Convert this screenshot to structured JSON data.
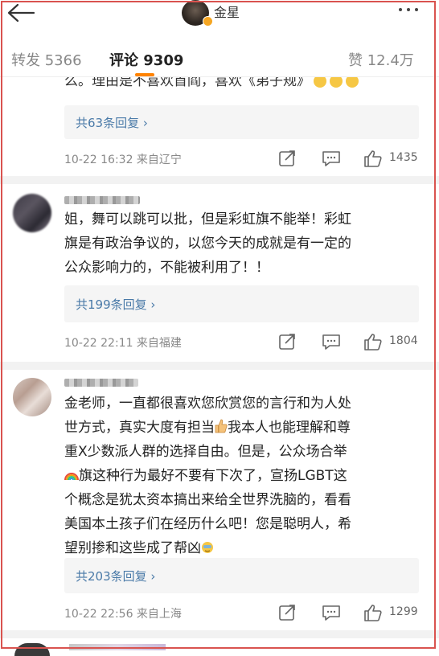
{
  "header": {
    "username": "金星",
    "back_icon": "back-arrow-icon",
    "more_icon": "more-dots-icon"
  },
  "tabs": [
    {
      "label": "转发 5366",
      "active": false
    },
    {
      "label": "评论 9309",
      "active": true
    },
    {
      "label": "赞 12.4万",
      "active": false
    }
  ],
  "accent_color": "#ff8200",
  "link_color": "#4a7aa8",
  "comments": [
    {
      "partial_text": "么。理由是不喜欢首阎，喜欢《弟子规》",
      "replies_label": "共63条回复 ›",
      "time_location": "10-22 16:32  来自辽宁",
      "likes": "1435"
    },
    {
      "lines": [
        "姐，舞可以跳可以批，但是彩虹旗不能举！彩虹",
        "旗是有政治争议的，以您今天的成就是有一定的",
        "公众影响力的，不能被利用了！！"
      ],
      "replies_label": "共199条回复 ›",
      "time_location": "10-22 22:11  来自福建",
      "likes": "1804"
    },
    {
      "lines": [
        "金老师，一直都很喜欢您欣赏您的言行和为人处",
        "世方式，真实大度有担当",
        "我本人也能理解和尊",
        "重X少数派人群的选择自由。但是，公众场合举",
        "旗这种行为最好不要有下次了，宣扬LGBT这",
        "个概念是犹太资本搞出来给全世界洗脑的，看看",
        "美国本土孩子们在经历什么吧！您是聪明人，希",
        "望别掺和这些成了帮凶"
      ],
      "replies_label": "共203条回复 ›",
      "time_location": "10-22 22:56  来自上海",
      "likes": "1299"
    }
  ]
}
